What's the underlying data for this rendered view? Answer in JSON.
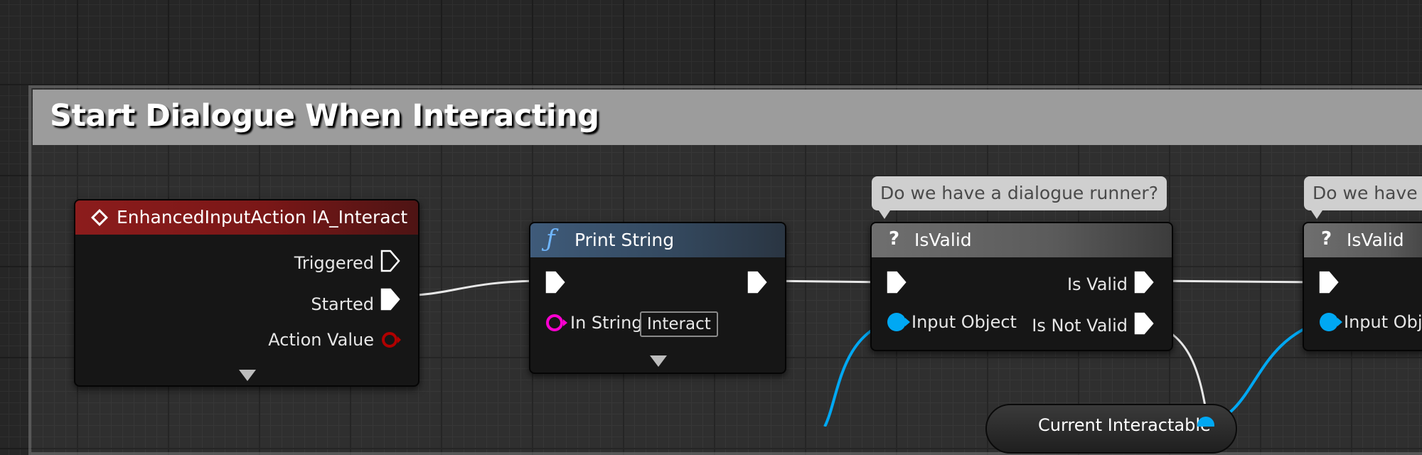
{
  "comment": {
    "title": "Start Dialogue When Interacting"
  },
  "nodes": {
    "enhanced_input": {
      "title": "EnhancedInputAction IA_Interact",
      "outputs": [
        "Triggered",
        "Started",
        "Action Value"
      ]
    },
    "print_string": {
      "title": "Print String",
      "input_label": "In String",
      "input_value": "Interact"
    },
    "is_valid_1": {
      "bubble": "Do we have a dialogue runner?",
      "title": "IsValid",
      "input_label": "Input Object",
      "outputs": [
        "Is Valid",
        "Is Not Valid"
      ]
    },
    "is_valid_2": {
      "bubble": "Do we have a",
      "title": "IsValid",
      "input_label": "Input Obje"
    },
    "variable": {
      "label": "Current Interactable"
    }
  },
  "colors": {
    "exec_pin": "#ffffff",
    "object_pin": "#00a8f3",
    "string_pin": "#fb00d0",
    "struct_pin": "#b00000",
    "event_header": "#8c1c1c",
    "function_header": "#3f5b7a",
    "macro_header": "#6f6f6f"
  },
  "icons": {
    "event": "diamond-event-icon",
    "function": "function-f-icon",
    "macro": "question-mark-icon"
  }
}
